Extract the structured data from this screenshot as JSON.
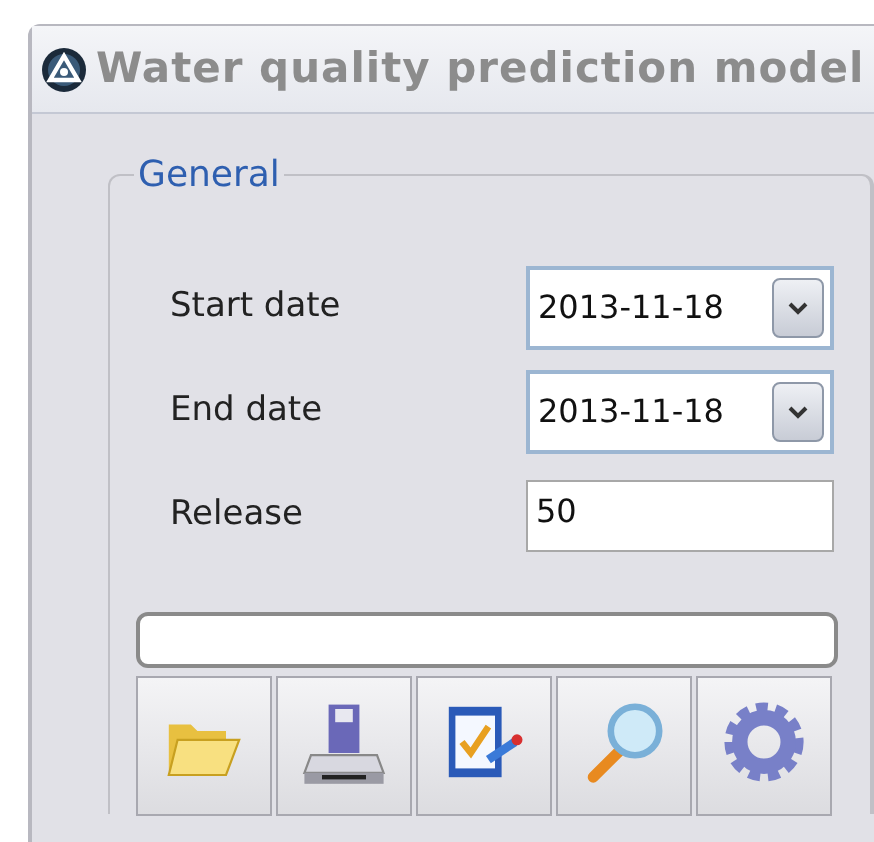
{
  "window": {
    "title": "Water quality prediction model"
  },
  "group": {
    "title": "General"
  },
  "fields": [
    {
      "kind": "date",
      "label": "Start date",
      "value": "2013-11-18"
    },
    {
      "kind": "date",
      "label": "End date",
      "value": "2013-11-18"
    },
    {
      "kind": "text",
      "label": "Release",
      "value": "50"
    }
  ],
  "progress": {
    "level": 0
  },
  "toolbar": [
    {
      "kind": "folder"
    },
    {
      "kind": "disk"
    },
    {
      "kind": "check"
    },
    {
      "kind": "magnifier"
    },
    {
      "kind": "gear"
    }
  ]
}
